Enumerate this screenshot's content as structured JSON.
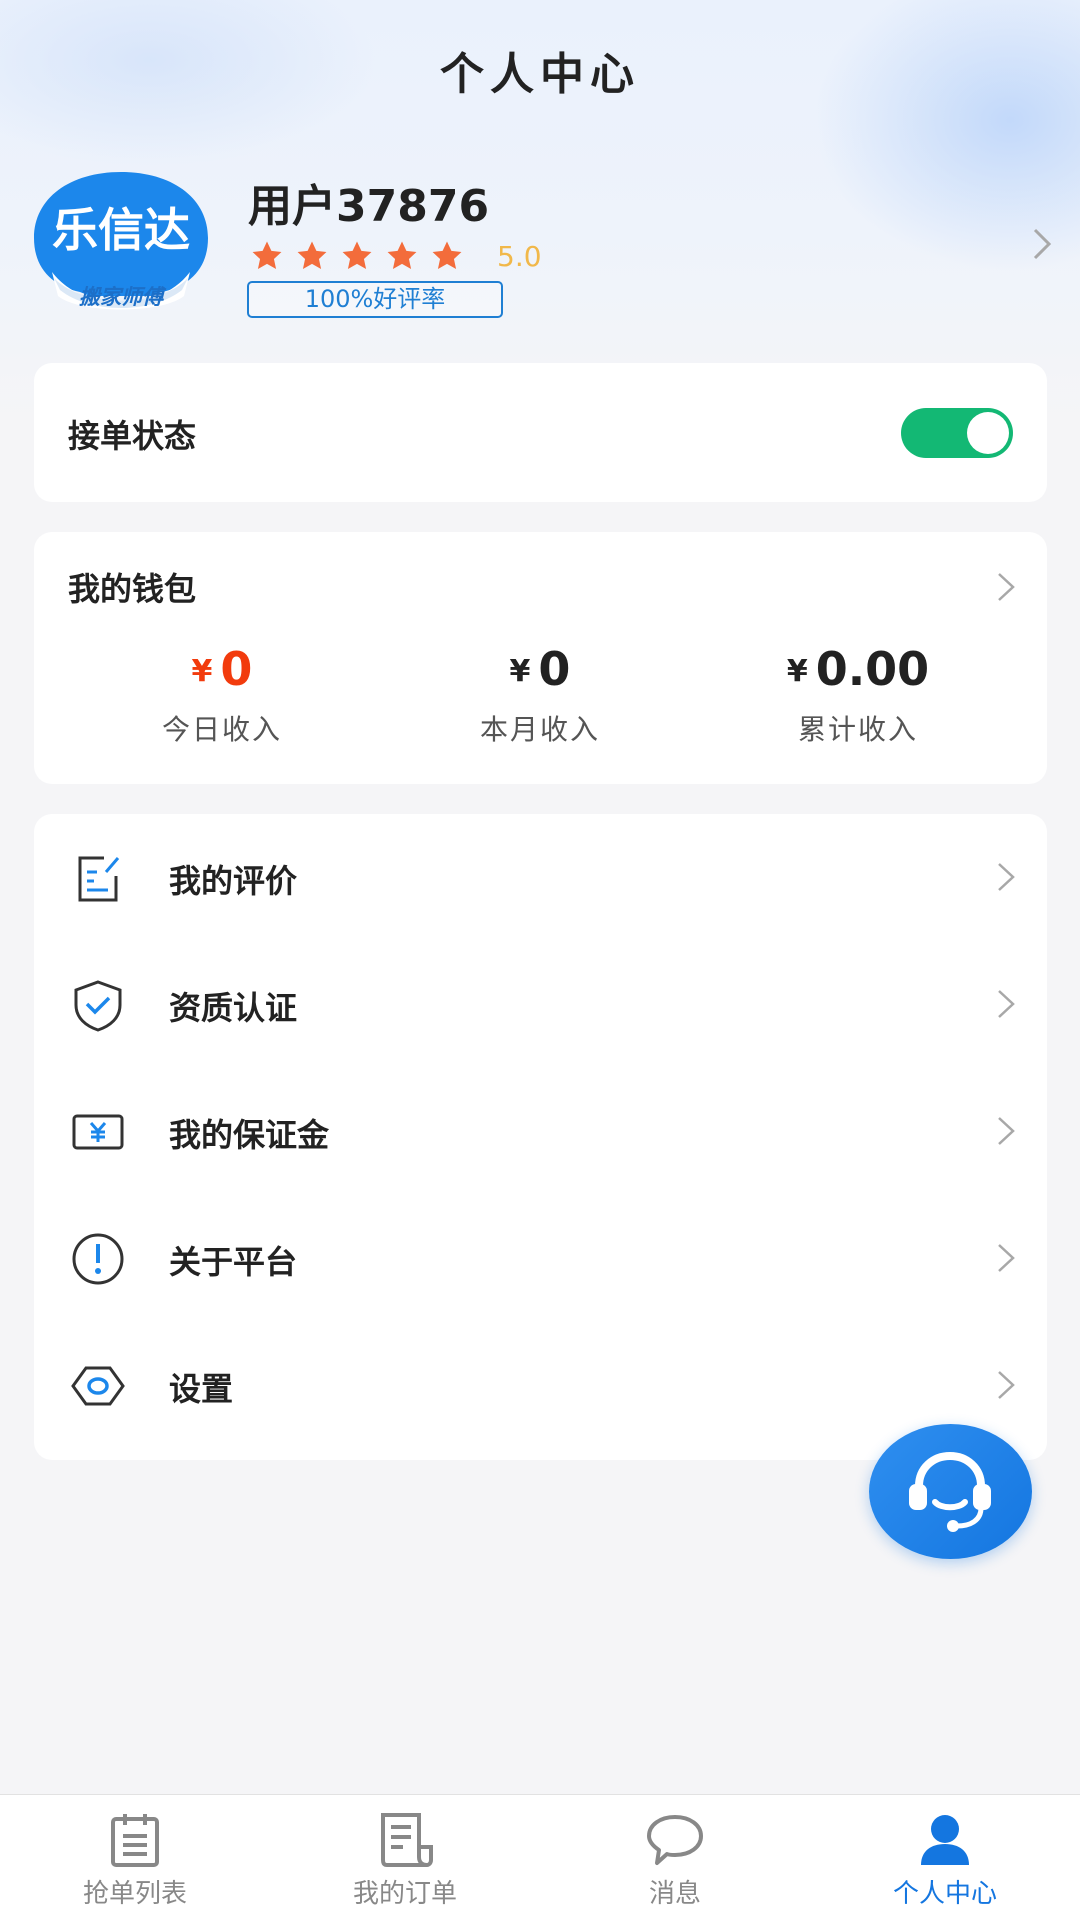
{
  "header": {
    "title": "个人中心"
  },
  "profile": {
    "logo_text": "乐信达",
    "logo_subtitle": "搬家师傅",
    "username": "用户37876",
    "rating_stars": 5,
    "rating_score": "5.0",
    "praise_rate": "100%好评率"
  },
  "order_status": {
    "label": "接单状态",
    "enabled": true
  },
  "wallet": {
    "title": "我的钱包",
    "currency_symbol": "¥",
    "stats": [
      {
        "value": "0",
        "label": "今日收入"
      },
      {
        "value": "0",
        "label": "本月收入"
      },
      {
        "value": "0.00",
        "label": "累计收入"
      }
    ]
  },
  "menu": {
    "items": [
      {
        "label": "我的评价",
        "icon": "edit-note-icon"
      },
      {
        "label": "资质认证",
        "icon": "shield-check-icon"
      },
      {
        "label": "我的保证金",
        "icon": "yen-card-icon"
      },
      {
        "label": "关于平台",
        "icon": "info-circle-icon"
      },
      {
        "label": "设置",
        "icon": "hexagon-settings-icon"
      }
    ]
  },
  "fab": {
    "icon": "customer-service-icon"
  },
  "tabbar": {
    "items": [
      {
        "label": "抢单列表",
        "icon": "clipboard-list-icon"
      },
      {
        "label": "我的订单",
        "icon": "order-document-icon"
      },
      {
        "label": "消息",
        "icon": "chat-bubble-icon"
      },
      {
        "label": "个人中心",
        "icon": "user-icon"
      }
    ],
    "active_index": 3
  },
  "colors": {
    "accent": "#1476e0",
    "toggle_on": "#13b874",
    "money_red": "#f23b0d",
    "star_orange": "#f36c3b",
    "rating_yellow": "#f1b84a"
  }
}
